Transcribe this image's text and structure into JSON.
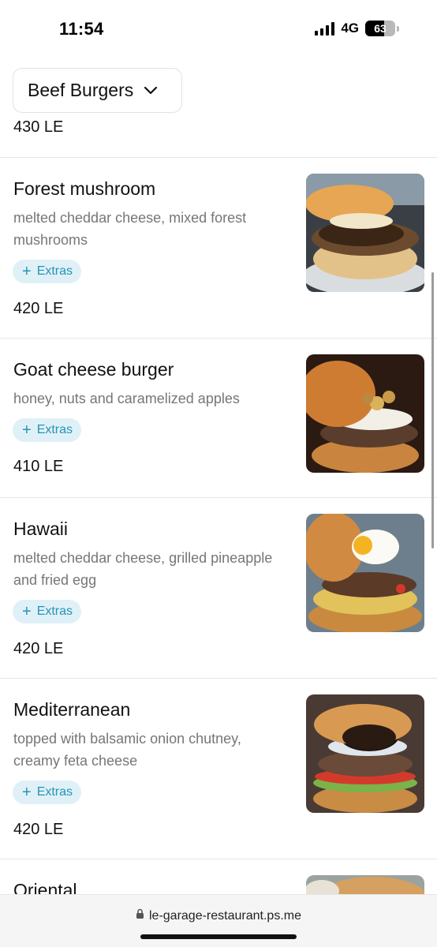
{
  "status_bar": {
    "time": "11:54",
    "network": "4G",
    "battery": "63",
    "battery_level": 0.63
  },
  "category": {
    "label": "Beef Burgers",
    "icon": "chevron-down-icon"
  },
  "previous_item_price": "430 LE",
  "items": [
    {
      "name": "Forest mushroom",
      "description": "melted cheddar cheese, mixed forest mushrooms",
      "extras_label": "Extras",
      "price": "420 LE",
      "image": "forest-mushroom-burger-photo"
    },
    {
      "name": "Goat cheese burger",
      "description": "honey, nuts and caramelized apples",
      "extras_label": "Extras",
      "price": "410 LE",
      "image": "goat-cheese-burger-photo"
    },
    {
      "name": "Hawaii",
      "description": "melted cheddar cheese, grilled pineapple and fried egg",
      "extras_label": "Extras",
      "price": "420 LE",
      "image": "hawaii-burger-photo"
    },
    {
      "name": "Mediterranean",
      "description": "topped with balsamic onion chutney, creamy feta cheese",
      "extras_label": "Extras",
      "price": "420 LE",
      "image": "mediterranean-burger-photo"
    },
    {
      "name": "Oriental",
      "image": "oriental-burger-photo"
    }
  ],
  "browser": {
    "url": "le-garage-restaurant.ps.me",
    "icon": "lock-icon"
  },
  "colors": {
    "accent": "#2594b8",
    "chip_bg": "#dff1f7",
    "muted_text": "#767676"
  }
}
